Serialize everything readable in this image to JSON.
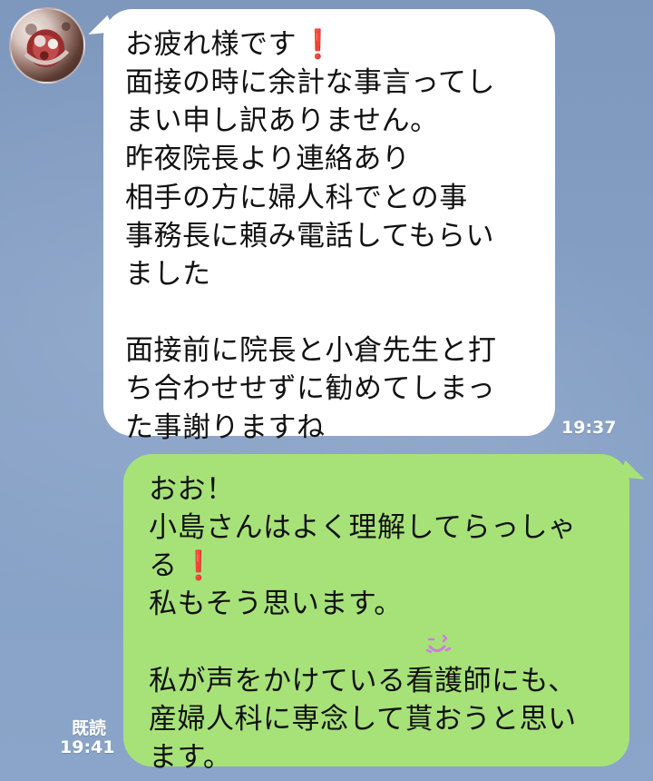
{
  "messages": [
    {
      "side": "left",
      "lines": [
        "お疲れ様です",
        "面接の時に余計な事言ってし",
        "まい申し訳ありません。",
        "昨夜院長より連絡あり",
        "相手の方に婦人科でとの事",
        "事務長に頼み電話してもらい",
        "ました",
        "",
        "面接前に院長と小倉先生と打",
        "ち合わせせずに勧めてしまっ",
        "た事謝りますね"
      ],
      "time": "19:37"
    },
    {
      "side": "right",
      "lines": [
        "おお！",
        "小島さんはよく理解してらっしゃ",
        "る",
        "私もそう思います。",
        "",
        "私が声をかけている看護師にも、",
        "産婦人科に専念して貰おうと思い",
        "ます。"
      ],
      "time": "19:41",
      "read": "既読"
    }
  ],
  "colors": {
    "background": "#86a0c5",
    "left_bubble": "#ffffff",
    "right_bubble": "#a7e279",
    "accent_exclaim": "#e0181e",
    "sparkle": "#d07be1",
    "sweat": "#2e5fd8"
  },
  "icons": {
    "avatar": "profile-photo",
    "exclamation": "exclamation-icon",
    "sweat": "sweat-face-icon",
    "sparkle": "sparkle-face-icon"
  }
}
